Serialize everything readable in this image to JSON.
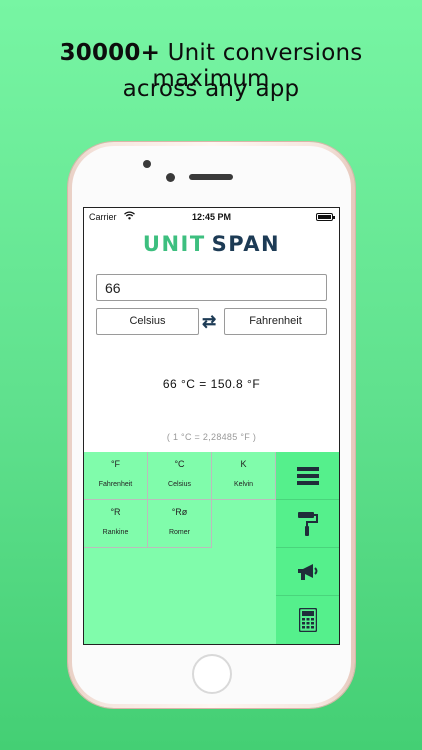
{
  "headline": {
    "bold": "30000+",
    "line1_rest": " Unit conversions maximum",
    "line2": "across any app"
  },
  "status_bar": {
    "carrier": "Carrier",
    "time": "12:45 PM"
  },
  "logo": {
    "part1": "UNIT",
    "part2": "SPAN"
  },
  "input": {
    "value": "66"
  },
  "units": {
    "from": "Celsius",
    "to": "Fahrenheit",
    "swap_icon": "⇄"
  },
  "result": "66 °C = 150.8 °F",
  "ratio": "( 1 °C = 2,28485 °F )",
  "unit_grid": [
    {
      "symbol": "°F",
      "name": "Fahrenheit"
    },
    {
      "symbol": "°C",
      "name": "Celsius"
    },
    {
      "symbol": "K",
      "name": "Kelvin"
    },
    {
      "symbol": "°R",
      "name": "Rankine"
    },
    {
      "symbol": "°Rø",
      "name": "Romer"
    }
  ],
  "side_toolbar": [
    "menu-icon",
    "paint-roller-icon",
    "megaphone-icon",
    "calculator-icon"
  ],
  "colors": {
    "accent_green": "#3dbf7f",
    "navy": "#1d3b55",
    "grid_green": "#80fcab",
    "toolbar_green": "#55f08c"
  }
}
